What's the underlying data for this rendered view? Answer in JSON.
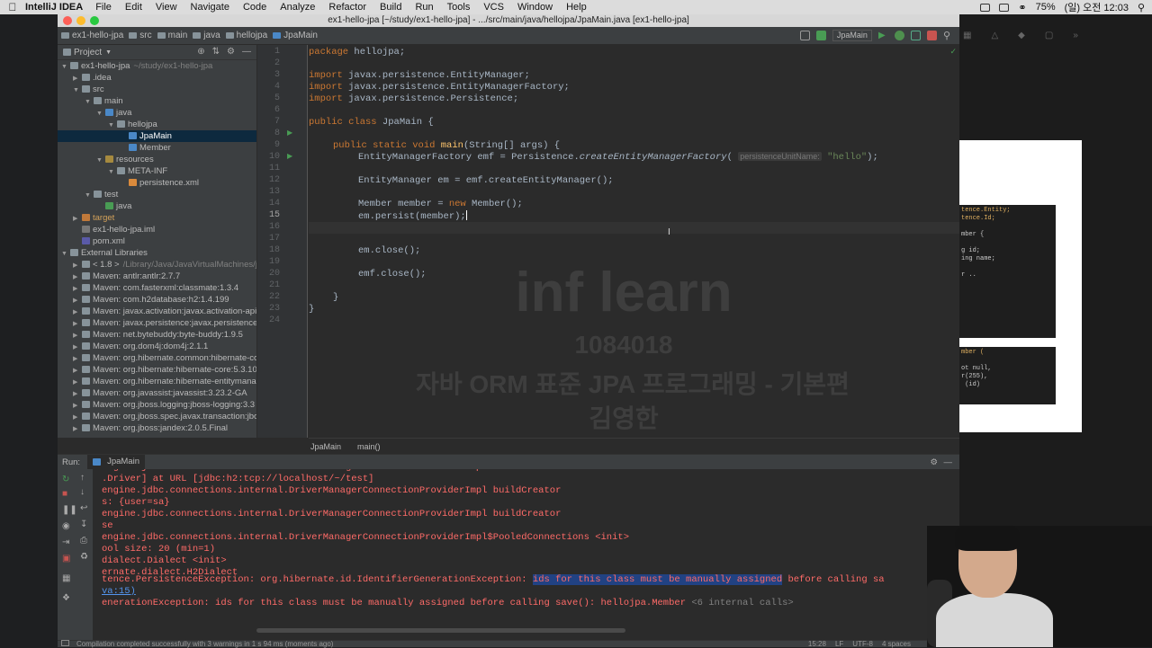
{
  "menubar": {
    "app": "IntelliJ IDEA",
    "items": [
      "File",
      "Edit",
      "View",
      "Navigate",
      "Code",
      "Analyze",
      "Refactor",
      "Build",
      "Run",
      "Tools",
      "VCS",
      "Window",
      "Help"
    ],
    "battery": "75%",
    "clock": "(일) 오전 12:03"
  },
  "window": {
    "title": "ex1-hello-jpa [~/study/ex1-hello-jpa] - .../src/main/java/hellojpa/JpaMain.java [ex1-hello-jpa]"
  },
  "breadcrumbs": [
    "ex1-hello-jpa",
    "src",
    "main",
    "java",
    "hellojpa",
    "JpaMain"
  ],
  "toolbar": {
    "run_config": "JpaMain"
  },
  "project": {
    "header": "Project",
    "tree": [
      {
        "label": "ex1-hello-jpa",
        "extra": "~/study/ex1-hello-jpa",
        "depth": 0,
        "open": true,
        "type": "module"
      },
      {
        "label": ".idea",
        "depth": 1,
        "open": false,
        "type": "folder"
      },
      {
        "label": "src",
        "depth": 1,
        "open": true,
        "type": "folder"
      },
      {
        "label": "main",
        "depth": 2,
        "open": true,
        "type": "folder"
      },
      {
        "label": "java",
        "depth": 3,
        "open": true,
        "type": "src"
      },
      {
        "label": "hellojpa",
        "depth": 4,
        "open": true,
        "type": "package"
      },
      {
        "label": "JpaMain",
        "depth": 5,
        "type": "class",
        "selected": true
      },
      {
        "label": "Member",
        "depth": 5,
        "type": "class"
      },
      {
        "label": "resources",
        "depth": 3,
        "open": true,
        "type": "res"
      },
      {
        "label": "META-INF",
        "depth": 4,
        "open": true,
        "type": "folder"
      },
      {
        "label": "persistence.xml",
        "depth": 5,
        "type": "xml"
      },
      {
        "label": "test",
        "depth": 2,
        "open": true,
        "type": "folder"
      },
      {
        "label": "java",
        "depth": 3,
        "type": "test"
      },
      {
        "label": "target",
        "depth": 1,
        "open": false,
        "type": "target"
      },
      {
        "label": "ex1-hello-jpa.iml",
        "depth": 1,
        "type": "iml"
      },
      {
        "label": "pom.xml",
        "depth": 1,
        "type": "pom"
      },
      {
        "label": "External Libraries",
        "depth": 0,
        "open": true,
        "type": "lib"
      },
      {
        "label": "< 1.8 >",
        "extra": "/Library/Java/JavaVirtualMachines/jdk",
        "depth": 1,
        "open": false,
        "type": "lib"
      },
      {
        "label": "Maven: antlr:antlr:2.7.7",
        "depth": 1,
        "open": false,
        "type": "lib"
      },
      {
        "label": "Maven: com.fasterxml:classmate:1.3.4",
        "depth": 1,
        "open": false,
        "type": "lib"
      },
      {
        "label": "Maven: com.h2database:h2:1.4.199",
        "depth": 1,
        "open": false,
        "type": "lib"
      },
      {
        "label": "Maven: javax.activation:javax.activation-api",
        "depth": 1,
        "open": false,
        "type": "lib"
      },
      {
        "label": "Maven: javax.persistence:javax.persistence",
        "depth": 1,
        "open": false,
        "type": "lib"
      },
      {
        "label": "Maven: net.bytebuddy:byte-buddy:1.9.5",
        "depth": 1,
        "open": false,
        "type": "lib"
      },
      {
        "label": "Maven: org.dom4j:dom4j:2.1.1",
        "depth": 1,
        "open": false,
        "type": "lib"
      },
      {
        "label": "Maven: org.hibernate.common:hibernate-co",
        "depth": 1,
        "open": false,
        "type": "lib"
      },
      {
        "label": "Maven: org.hibernate:hibernate-core:5.3.10",
        "depth": 1,
        "open": false,
        "type": "lib"
      },
      {
        "label": "Maven: org.hibernate:hibernate-entitymana",
        "depth": 1,
        "open": false,
        "type": "lib"
      },
      {
        "label": "Maven: org.javassist:javassist:3.23.2-GA",
        "depth": 1,
        "open": false,
        "type": "lib"
      },
      {
        "label": "Maven: org.jboss.logging:jboss-logging:3.3",
        "depth": 1,
        "open": false,
        "type": "lib"
      },
      {
        "label": "Maven: org.jboss.spec.javax.transaction:jbo",
        "depth": 1,
        "open": false,
        "type": "lib"
      },
      {
        "label": "Maven: org.jboss:jandex:2.0.5.Final",
        "depth": 1,
        "open": false,
        "type": "lib"
      }
    ]
  },
  "editor": {
    "line_numbers": [
      "1",
      "2",
      "3",
      "4",
      "5",
      "6",
      "7",
      "8",
      "9",
      "10",
      "11",
      "12",
      "13",
      "14",
      "15",
      "16",
      "17",
      "18",
      "19",
      "20",
      "21",
      "22",
      "23",
      "24"
    ],
    "current_line": "15",
    "code": {
      "l1_kw": "package",
      "l1_rest": " hellojpa;",
      "l3_kw": "import",
      "l3_rest": " javax.persistence.EntityManager;",
      "l4_kw": "import",
      "l4_rest": " javax.persistence.EntityManagerFactory;",
      "l5_kw": "import",
      "l5_rest": " javax.persistence.Persistence;",
      "l7_kw": "public class",
      "l7_name": " JpaMain",
      "l7_rest": " {",
      "l9_kw": "public static void",
      "l9_fn": " main",
      "l9_rest": "(String[] args) {",
      "l10_a": "EntityManagerFactory emf = Persistence.",
      "l10_call": "createEntityManagerFactory",
      "l10_b": "(",
      "l10_hint": "persistenceUnitName:",
      "l10_str": "\"hello\"",
      "l10_c": ");",
      "l12": "EntityManager em = emf.createEntityManager();",
      "l14_a": "Member member = ",
      "l14_kw": "new",
      "l14_b": " Member();",
      "l15": "em.persist(member);",
      "l18": "em.close();",
      "l20": "emf.close();",
      "l22": "}",
      "l23": "}"
    },
    "watermark": {
      "brand": "inf learn",
      "id": "1084018",
      "course": "자바 ORM 표준 JPA 프로그래밍 - 기본편",
      "author": "김영한"
    },
    "footer_crumbs": [
      "JpaMain",
      "main()"
    ]
  },
  "run": {
    "label": "Run:",
    "tab": "JpaMain",
    "lines": [
      "engine.jdbc.connections.internal.DriverManagerConnectionProviderImpl buildCreator",
      ".Driver] at URL [jdbc:h2:tcp://localhost/~/test]",
      "engine.jdbc.connections.internal.DriverManagerConnectionProviderImpl buildCreator",
      "s: {user=sa}",
      "engine.jdbc.connections.internal.DriverManagerConnectionProviderImpl buildCreator",
      "se",
      "engine.jdbc.connections.internal.DriverManagerConnectionProviderImpl$PooledConnections <init>",
      "ool size: 20 (min=1)",
      "dialect.Dialect <init>",
      "ernate.dialect.H2Dialect"
    ],
    "exception_prefix": "tence.PersistenceException: org.hibernate.id.IdentifierGenerationException: ",
    "exception_highlight": "ids for this class must be manually assigned",
    "exception_suffix": " before calling sa",
    "trace_link": "va:15)",
    "last_line": "enerationException: ids for this class must be manually assigned before calling save(): hellojpa.Member ",
    "internal_calls": "<6 internal calls>"
  },
  "status": {
    "message": "Compilation completed successfully with 3 warnings in 1 s 94 ms (moments ago)",
    "position": "15:28",
    "line_sep": "LF",
    "encoding": "UTF-8",
    "indent": "4 spaces"
  },
  "slide": {
    "snippet1": [
      "tence.Entity;",
      "tence.Id;",
      "",
      "mber {",
      "",
      "g id;",
      "ing name;",
      "",
      "r .."
    ],
    "snippet2": [
      "mber (",
      "",
      "ot null,",
      "r(255),",
      " (id)"
    ]
  },
  "colors": {
    "accent": "#0d293e",
    "error": "#ff6b68",
    "keyword": "#cc7832",
    "string": "#6a8759",
    "function": "#ffc66d"
  }
}
